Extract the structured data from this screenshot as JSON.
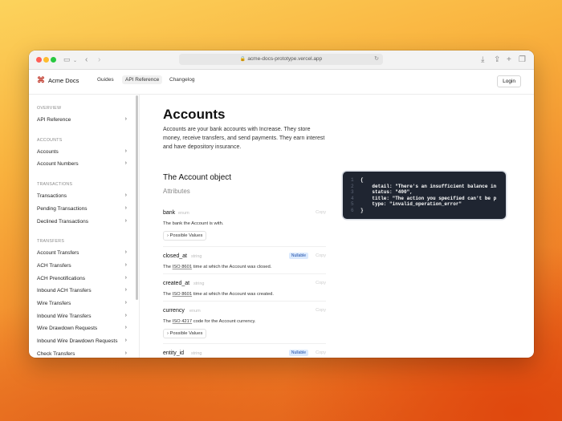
{
  "browser": {
    "url": "acme-docs-prototype.vercel.app"
  },
  "header": {
    "brand": "Acme Docs",
    "nav": [
      "Guides",
      "API Reference",
      "Changelog"
    ],
    "login": "Login"
  },
  "sidebar": {
    "sections": [
      {
        "title": "OVERVIEW",
        "items": [
          "API Reference"
        ]
      },
      {
        "title": "ACCOUNTS",
        "items": [
          "Accounts",
          "Account Numbers"
        ]
      },
      {
        "title": "TRANSACTIONS",
        "items": [
          "Transactions",
          "Pending Transactions",
          "Declined Transactions"
        ]
      },
      {
        "title": "TRANSFERS",
        "items": [
          "Account Transfers",
          "ACH Transfers",
          "ACH Prenotifications",
          "Inbound ACH Transfers",
          "Wire Transfers",
          "Inbound Wire Transfers",
          "Wire Drawdown Requests",
          "Inbound Wire Drawdown Requests",
          "Check Transfers"
        ]
      }
    ]
  },
  "page": {
    "title": "Accounts",
    "intro": "Accounts are your bank accounts with Increase. They store money, receive transfers, and send payments. They earn interest and have depository insurance.",
    "object_title": "The Account object",
    "attributes_label": "Attributes",
    "copy_label": "Copy",
    "nullable_label": "Nullable",
    "possible_values_label": "Possible Values",
    "attributes": [
      {
        "name": "bank",
        "type": "enum",
        "desc_pre": "The bank the Account is with.",
        "link": "",
        "desc_post": "",
        "nullable": false,
        "possible": true
      },
      {
        "name": "closed_at",
        "type": "string",
        "desc_pre": "The ",
        "link": "ISO 8601",
        "desc_post": " time at which the Account was closed.",
        "nullable": true,
        "possible": false
      },
      {
        "name": "created_at",
        "type": "string",
        "desc_pre": "The ",
        "link": "ISO 8601",
        "desc_post": " time at which the Account was created.",
        "nullable": false,
        "possible": false
      },
      {
        "name": "currency",
        "type": "enum",
        "desc_pre": "The ",
        "link": "ISO 4217",
        "desc_post": " code for the Account currency.",
        "nullable": false,
        "possible": true
      },
      {
        "name": "entity_id",
        "type": "string",
        "desc_pre": "",
        "link": "",
        "desc_post": "",
        "nullable": true,
        "possible": false
      }
    ]
  },
  "code": {
    "lines": [
      {
        "n": "1",
        "text": "{"
      },
      {
        "n": "2",
        "text": "    detail: \"There's an insufficient balance in"
      },
      {
        "n": "3",
        "text": "    status: \"400\","
      },
      {
        "n": "4",
        "text": "    title: \"The action you specified can't be p"
      },
      {
        "n": "5",
        "text": "    type: \"invalid_operation_error\""
      },
      {
        "n": "6",
        "text": "}"
      }
    ]
  }
}
